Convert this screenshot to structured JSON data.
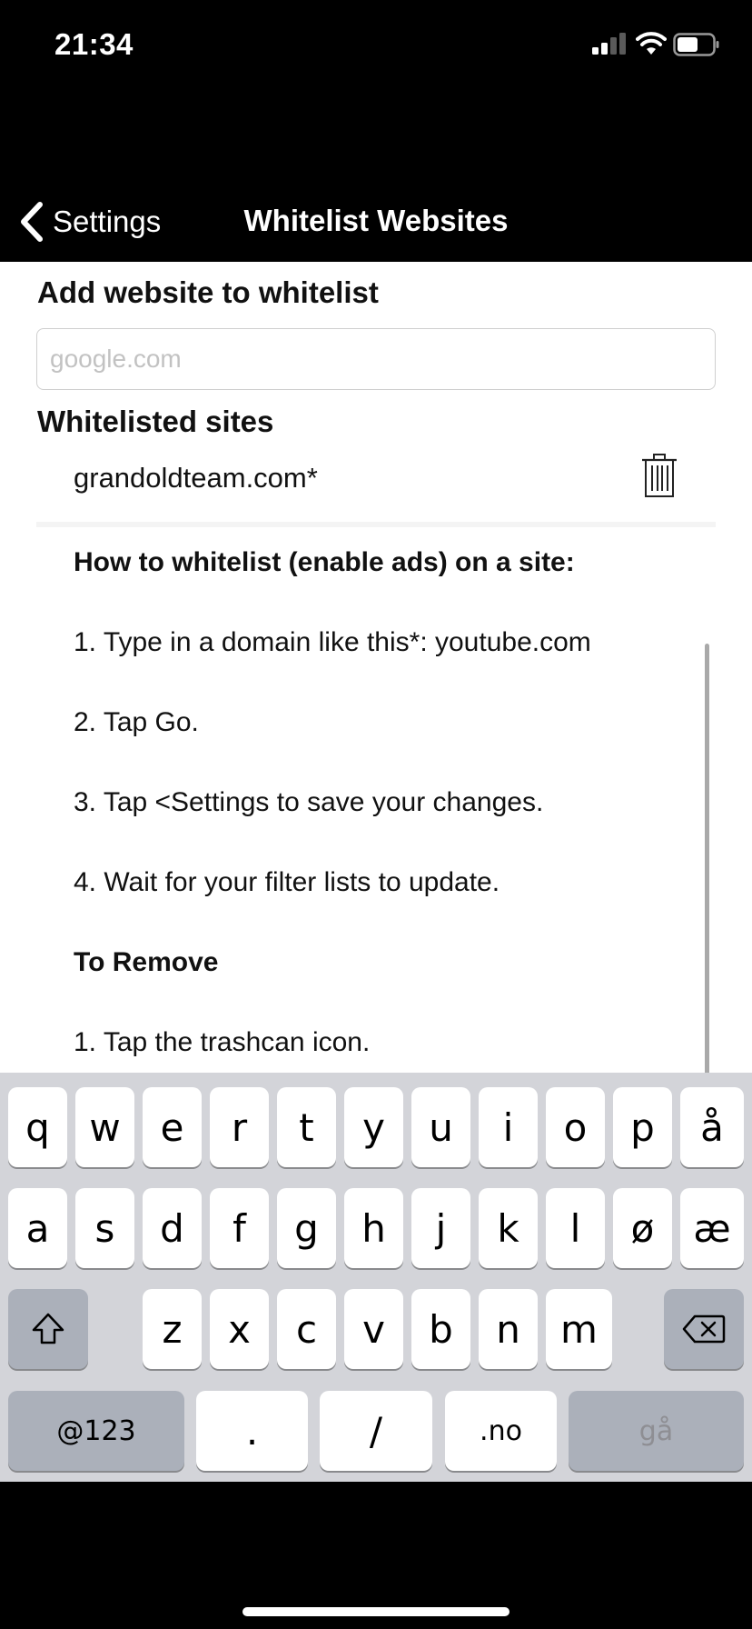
{
  "status_bar": {
    "time": "21:34"
  },
  "nav": {
    "back_label": "Settings",
    "title": "Whitelist Websites"
  },
  "add_section": {
    "title": "Add website to whitelist",
    "placeholder": "google.com",
    "value": ""
  },
  "whitelisted": {
    "title": "Whitelisted sites",
    "sites": [
      "grandoldteam.com*"
    ]
  },
  "help": {
    "heading": "How to whitelist (enable ads) on a site:",
    "steps": [
      "1. Type in a domain like this*: youtube.com",
      "2. Tap Go.",
      "3. Tap <Settings to save your changes.",
      "4. Wait for your filter lists to update."
    ],
    "remove_heading": "To Remove",
    "remove_steps": [
      "1. Tap the trashcan icon."
    ]
  },
  "keyboard": {
    "row1": [
      "q",
      "w",
      "e",
      "r",
      "t",
      "y",
      "u",
      "i",
      "o",
      "p",
      "å"
    ],
    "row2": [
      "a",
      "s",
      "d",
      "f",
      "g",
      "h",
      "j",
      "k",
      "l",
      "ø",
      "æ"
    ],
    "row3": [
      "z",
      "x",
      "c",
      "v",
      "b",
      "n",
      "m"
    ],
    "numbers_label": "@123",
    "dot_label": ".",
    "slash_label": "/",
    "tld_label": ".no",
    "go_label": "gå"
  },
  "colors": {
    "background": "#000000",
    "content": "#ffffff",
    "keyboard": "#d3d4d9",
    "dark_key": "#abb0ba",
    "placeholder": "#c2c2c2"
  }
}
